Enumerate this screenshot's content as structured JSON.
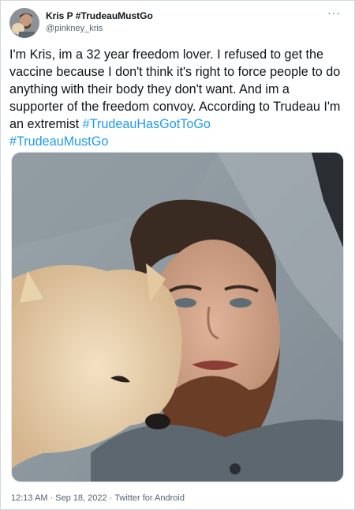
{
  "tweet": {
    "author": {
      "display_name": "Kris P #TrudeauMustGo",
      "handle": "@pinkney_kris",
      "avatar_icon": "profile-photo-avatar"
    },
    "more_label": "···",
    "text_main": "I'm Kris, im a 32 year freedom lover. I refused to get the vaccine because I don't think it's right to force people to do anything with their body they don't want. And im a supporter of the freedom convoy. According to Trudeau I'm an extremist ",
    "hashtags": [
      "#TrudeauHasGotToGo",
      "#TrudeauMustGo"
    ],
    "meta": {
      "time": "12:13 AM",
      "separator": "·",
      "date": "Sep 18, 2022",
      "client": "Twitter for Android"
    }
  },
  "colors": {
    "link": "#1d9bf0",
    "secondary_text": "#536471",
    "primary_text": "#0f1419"
  }
}
